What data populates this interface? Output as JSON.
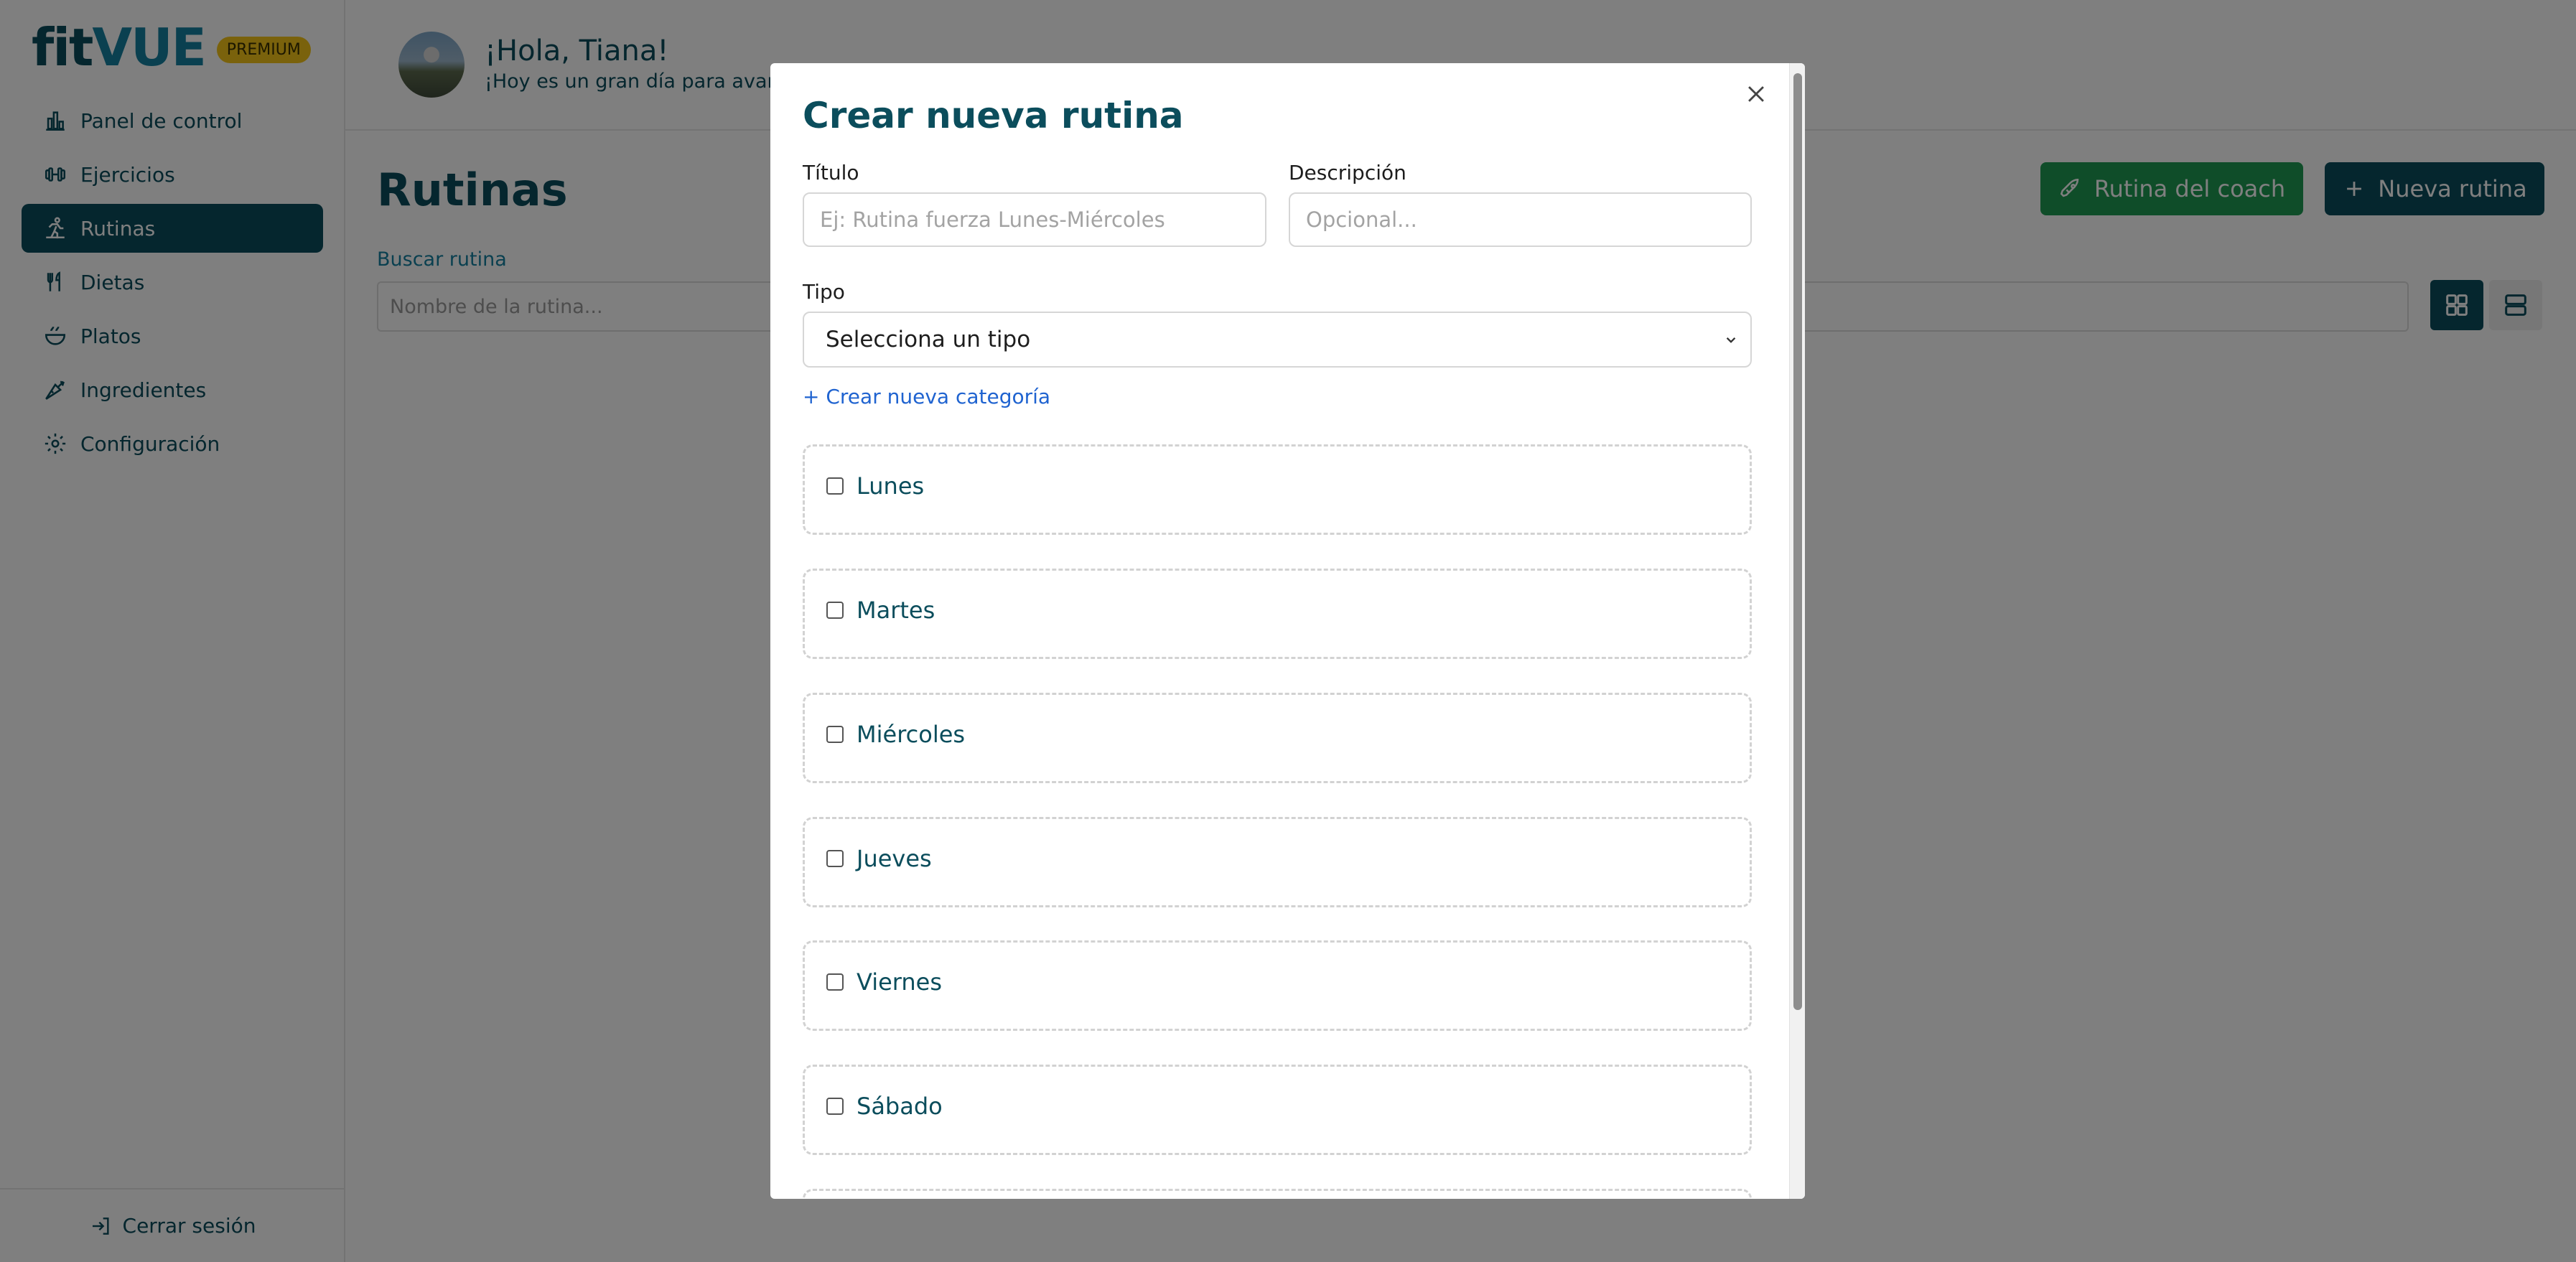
{
  "brand": {
    "fit": "fit",
    "vue": "VUE",
    "badge": "PREMIUM"
  },
  "sidebar": {
    "items": [
      {
        "label": "Panel de control",
        "icon": "chart-bar-icon",
        "active": false
      },
      {
        "label": "Ejercicios",
        "icon": "dumbbell-icon",
        "active": false
      },
      {
        "label": "Rutinas",
        "icon": "running-icon",
        "active": true
      },
      {
        "label": "Dietas",
        "icon": "utensils-icon",
        "active": false
      },
      {
        "label": "Platos",
        "icon": "bowl-icon",
        "active": false
      },
      {
        "label": "Ingredientes",
        "icon": "carrot-icon",
        "active": false
      },
      {
        "label": "Configuración",
        "icon": "gear-icon",
        "active": false
      }
    ],
    "logout_label": "Cerrar sesión"
  },
  "header": {
    "greeting": "¡Hola, Tiana!",
    "subgreeting": "¡Hoy es un gran día para avan"
  },
  "main": {
    "title": "Rutinas",
    "search_label": "Buscar rutina",
    "search_placeholder": "Nombre de la rutina...",
    "coach_button": "Rutina del coach",
    "new_button": "Nueva rutina"
  },
  "modal": {
    "title": "Crear nueva rutina",
    "title_field_label": "Título",
    "title_field_placeholder": "Ej: Rutina fuerza Lunes-Miércoles",
    "description_label": "Descripción",
    "description_placeholder": "Opcional...",
    "type_label": "Tipo",
    "type_selected": "Selecciona un tipo",
    "new_category_link": "+ Crear nueva categoría",
    "days": [
      "Lunes",
      "Martes",
      "Miércoles",
      "Jueves",
      "Viernes",
      "Sábado"
    ]
  },
  "colors": {
    "primary": "#0b4d5c",
    "accent_green": "#1e9b52",
    "premium": "#f5c518",
    "link": "#1f63d0"
  }
}
